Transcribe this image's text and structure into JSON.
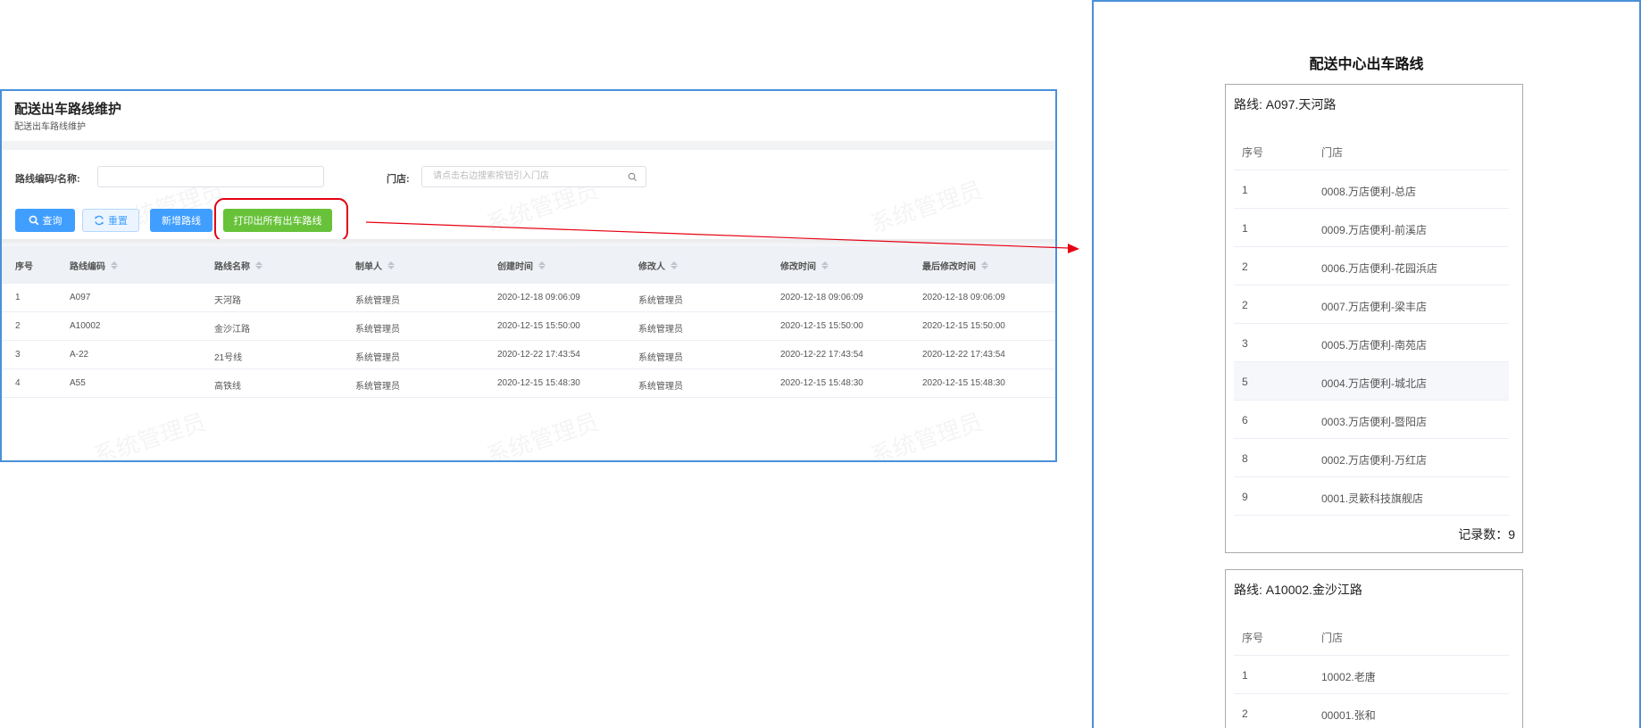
{
  "left": {
    "title": "配送出车路线维护",
    "subtitle": "配送出车路线维护",
    "filters": {
      "code_label": "路线编码/名称:",
      "code_value": "",
      "store_label": "门店:",
      "store_placeholder": "请点击右边搜索按钮引入门店"
    },
    "buttons": {
      "query": "查询",
      "reset": "重置",
      "add": "新增路线",
      "print": "打印出所有出车路线"
    },
    "columns": [
      "序号",
      "路线编码",
      "路线名称",
      "制单人",
      "创建时间",
      "修改人",
      "修改时间",
      "最后修改时间"
    ],
    "rows": [
      [
        "1",
        "A097",
        "天河路",
        "系统管理员",
        "2020-12-18 09:06:09",
        "系统管理员",
        "2020-12-18 09:06:09",
        "2020-12-18 09:06:09"
      ],
      [
        "2",
        "A10002",
        "金沙江路",
        "系统管理员",
        "2020-12-15 15:50:00",
        "系统管理员",
        "2020-12-15 15:50:00",
        "2020-12-15 15:50:00"
      ],
      [
        "3",
        "A-22",
        "21号线",
        "系统管理员",
        "2020-12-22 17:43:54",
        "系统管理员",
        "2020-12-22 17:43:54",
        "2020-12-22 17:43:54"
      ],
      [
        "4",
        "A55",
        "高铁线",
        "系统管理员",
        "2020-12-15 15:48:30",
        "系统管理员",
        "2020-12-15 15:48:30",
        "2020-12-15 15:48:30"
      ]
    ],
    "watermark": "系统管理员"
  },
  "right": {
    "title": "配送中心出车路线",
    "routes": [
      {
        "name": "路线: A097.天河路",
        "columns": [
          "序号",
          "门店"
        ],
        "rows": [
          [
            "1",
            "0008.万店便利-总店"
          ],
          [
            "1",
            "0009.万店便利-前溪店"
          ],
          [
            "2",
            "0006.万店便利-花园浜店"
          ],
          [
            "2",
            "0007.万店便利-梁丰店"
          ],
          [
            "3",
            "0005.万店便利-南苑店"
          ],
          [
            "5",
            "0004.万店便利-城北店"
          ],
          [
            "6",
            "0003.万店便利-暨阳店"
          ],
          [
            "8",
            "0002.万店便利-万红店"
          ],
          [
            "9",
            "0001.灵簌科技旗舰店"
          ]
        ],
        "record_count": "记录数：9"
      },
      {
        "name": "路线: A10002.金沙江路",
        "columns": [
          "序号",
          "门店"
        ],
        "rows": [
          [
            "1",
            "10002.老唐"
          ],
          [
            "2",
            "00001.张和"
          ]
        ]
      }
    ]
  },
  "colors": {
    "primary": "#409eff",
    "success": "#67c23a",
    "annotation": "#e60012",
    "window_border": "#4a90d9"
  },
  "icons": {
    "query": "search-icon",
    "reset": "refresh-icon",
    "store_search": "search-icon"
  }
}
